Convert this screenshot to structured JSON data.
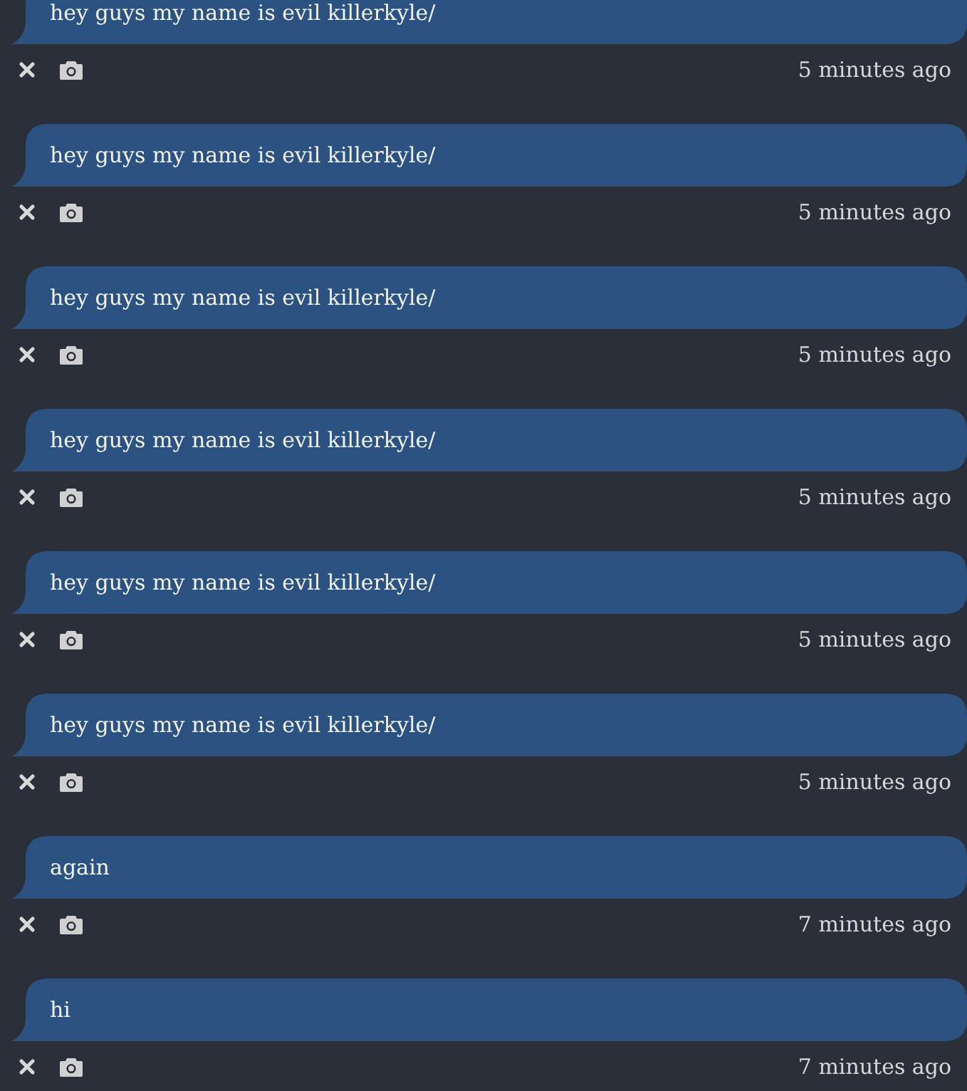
{
  "messages": [
    {
      "text": "hey guys my name is evil killerkyle/",
      "time": "5 minutes ago"
    },
    {
      "text": "hey guys my name is evil killerkyle/",
      "time": "5 minutes ago"
    },
    {
      "text": "hey guys my name is evil killerkyle/",
      "time": "5 minutes ago"
    },
    {
      "text": "hey guys my name is evil killerkyle/",
      "time": "5 minutes ago"
    },
    {
      "text": "hey guys my name is evil killerkyle/",
      "time": "5 minutes ago"
    },
    {
      "text": "hey guys my name is evil killerkyle/",
      "time": "5 minutes ago"
    },
    {
      "text": "again",
      "time": "7 minutes ago"
    },
    {
      "text": "hi",
      "time": "7 minutes ago"
    }
  ]
}
